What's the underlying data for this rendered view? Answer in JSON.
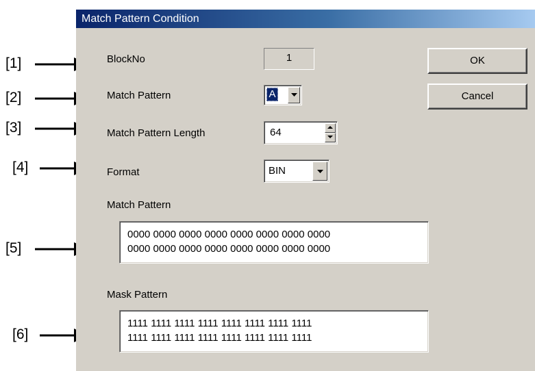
{
  "callouts": [
    "[1]",
    "[2]",
    "[3]",
    "[4]",
    "[5]",
    "[6]"
  ],
  "dialog": {
    "title": "Match Pattern Condition",
    "block_no_label": "BlockNo",
    "block_no_value": "1",
    "match_pattern_label": "Match Pattern",
    "match_pattern_value": "A",
    "length_label": "Match Pattern Length",
    "length_value": "64",
    "format_label": "Format",
    "format_value": "BIN",
    "match_pattern_section_label": "Match Pattern",
    "match_pattern_lines": [
      "0000 0000 0000 0000 0000 0000 0000 0000",
      "0000 0000 0000 0000 0000 0000 0000 0000"
    ],
    "mask_pattern_section_label": "Mask Pattern",
    "mask_pattern_lines": [
      "1111 1111 1111 1111 1111 1111 1111 1111",
      "1111 1111 1111 1111 1111 1111 1111 1111"
    ],
    "ok_label": "OK",
    "cancel_label": "Cancel"
  },
  "icons": [
    "dropdown-arrow-icon",
    "spin-up-icon",
    "spin-down-icon",
    "callout-arrow-icon"
  ]
}
